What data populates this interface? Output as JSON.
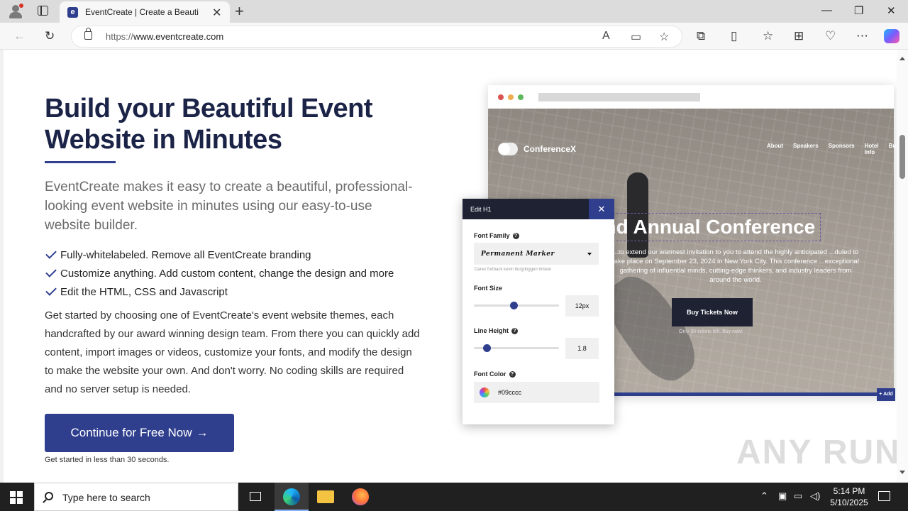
{
  "browser": {
    "tab_title": "EventCreate | Create a Beautiful E",
    "favicon_letter": "e",
    "url_proto": "https://",
    "url_host": "www.eventcreate.com"
  },
  "hero": {
    "title": "Build your Beautiful Event Website in Minutes",
    "lead": "EventCreate makes it easy to create a beautiful, professional-looking event website in minutes using our easy-to-use website builder.",
    "features": [
      "Fully-whitelabeled. Remove all EventCreate branding",
      "Customize anything. Add custom content, change the design and more",
      "Edit the HTML, CSS and Javascript"
    ],
    "body": "Get started by choosing one of EventCreate's event website themes, each handcrafted by our award winning design team. From there you can quickly add content, import images or videos, customize your fonts, and modify the design to make the website your own. And don't worry. No coding skills are required and no server setup is needed.",
    "cta_label": "Continue for Free Now",
    "cta_sub": "Get started in less than 30 seconds."
  },
  "mockup": {
    "brand": "ConferenceX",
    "nav": [
      "About",
      "Speakers",
      "Sponsors",
      "Hotel Info",
      "Buy"
    ],
    "heading": "2nd Annual Conference",
    "paragraph": "...to extend our warmest invitation to you to attend the highly anticipated ...duled to take place on September 23, 2024 in New York City. This conference ...exceptional gathering of influential minds, cutting-edge thinkers, and industry leaders from around the world.",
    "button": "Buy Tickets Now",
    "note": "Only 30 tickets left. Buy now!",
    "add_label": "+ Add"
  },
  "editor": {
    "title": "Edit H1",
    "close": "✕",
    "font_family_label": "Font Family",
    "font_family_value": "Permanent Marker",
    "font_preview": "Daner fortback kevin burgdoggen brisket",
    "font_size_label": "Font Size",
    "font_size_value": "12px",
    "font_size_level": 0.47,
    "line_height_label": "Line Height",
    "line_height_value": "1.8",
    "line_height_level": 0.12,
    "font_color_label": "Font Color",
    "font_color_value": "#09cccc"
  },
  "watermark": "ANY RUN",
  "taskbar": {
    "search_placeholder": "Type here to search",
    "time": "5:14 PM",
    "date": "5/10/2025"
  },
  "colors": {
    "brand_navy": "#2f3f8e",
    "heading": "#1b2347"
  }
}
